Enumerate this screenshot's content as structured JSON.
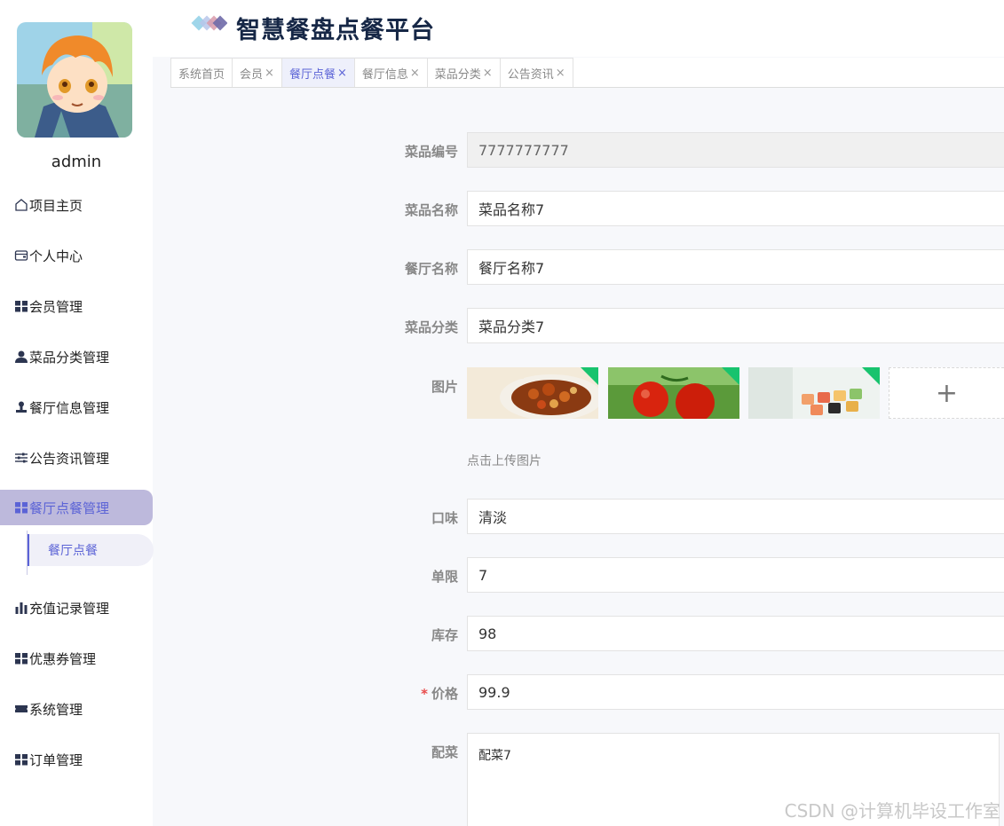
{
  "app": {
    "title": "智慧餐盘点餐平台"
  },
  "user": {
    "name": "admin"
  },
  "sidebar": {
    "items": [
      {
        "label": "项目主页",
        "icon": "home-icon"
      },
      {
        "label": "个人中心",
        "icon": "wallet-icon"
      },
      {
        "label": "会员管理",
        "icon": "grid-icon"
      },
      {
        "label": "菜品分类管理",
        "icon": "user-icon"
      },
      {
        "label": "餐厅信息管理",
        "icon": "stamp-icon"
      },
      {
        "label": "公告资讯管理",
        "icon": "sliders-icon"
      },
      {
        "label": "餐厅点餐管理",
        "icon": "grid-icon",
        "active": true
      },
      {
        "label": "充值记录管理",
        "icon": "bar-chart-icon"
      },
      {
        "label": "优惠券管理",
        "icon": "grid-icon"
      },
      {
        "label": "系统管理",
        "icon": "ticket-icon"
      },
      {
        "label": "订单管理",
        "icon": "grid-icon"
      }
    ],
    "submenu": {
      "label": "餐厅点餐"
    }
  },
  "tabs": [
    {
      "label": "系统首页",
      "closable": false
    },
    {
      "label": "会员",
      "closable": true
    },
    {
      "label": "餐厅点餐",
      "closable": true,
      "active": true
    },
    {
      "label": "餐厅信息",
      "closable": true
    },
    {
      "label": "菜品分类",
      "closable": true
    },
    {
      "label": "公告资讯",
      "closable": true
    }
  ],
  "tab_close_glyph": "×",
  "form": {
    "dish_code": {
      "label": "菜品编号",
      "value": "7777777777"
    },
    "dish_name": {
      "label": "菜品名称",
      "value": "菜品名称7"
    },
    "restaurant_name": {
      "label": "餐厅名称",
      "value": "餐厅名称7"
    },
    "dish_category": {
      "label": "菜品分类",
      "value": "菜品分类7"
    },
    "images": {
      "label": "图片",
      "upload_hint": "点击上传图片",
      "add_glyph": "+"
    },
    "taste": {
      "label": "口味",
      "value": "清淡"
    },
    "limit": {
      "label": "单限",
      "value": "7"
    },
    "stock": {
      "label": "库存",
      "value": "98"
    },
    "price": {
      "label": "价格",
      "value": "99.9",
      "required_mark": "*"
    },
    "side_dish": {
      "label": "配菜",
      "value": "配菜7"
    }
  },
  "watermark": "CSDN @计算机毕设工作室",
  "colors": {
    "accent": "#5b63d6",
    "active_bg": "#bdb9dc",
    "title": "#162746",
    "required": "#e84b4b"
  }
}
